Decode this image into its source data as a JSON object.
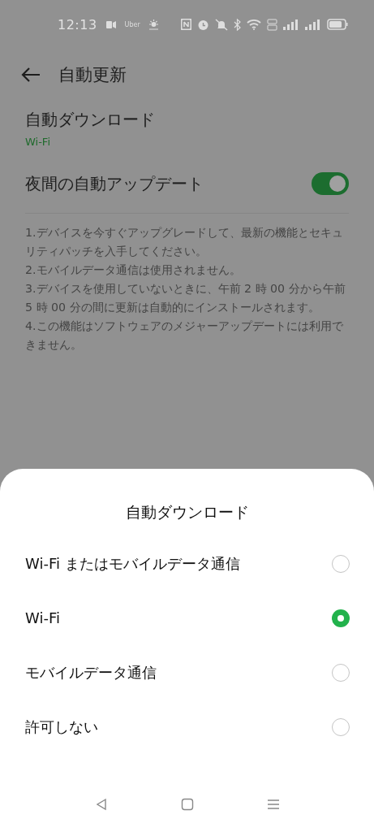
{
  "status_bar": {
    "time": "12:13",
    "app_label": "Uber"
  },
  "header": {
    "title": "自動更新"
  },
  "settings": [
    {
      "kind": "value",
      "title": "自動ダウンロード",
      "value": "Wi-Fi"
    },
    {
      "kind": "toggle",
      "title": "夜間の自動アップデート",
      "on": true
    }
  ],
  "notes": [
    "1.デバイスを今すぐアップグレードして、最新の機能とセキュリティパッチを入手してください。",
    "2.モバイルデータ通信は使用されません。",
    "3.デバイスを使用していないときに、午前 2 時 00 分から午前 5 時 00 分の間に更新は自動的にインストールされます。",
    "4.この機能はソフトウェアのメジャーアップデートには利用できません。"
  ],
  "sheet": {
    "title": "自動ダウンロード",
    "options": [
      {
        "label": "Wi-Fi またはモバイルデータ通信",
        "selected": false
      },
      {
        "label": "Wi-Fi",
        "selected": true
      },
      {
        "label": "モバイルデータ通信",
        "selected": false
      },
      {
        "label": "許可しない",
        "selected": false
      }
    ]
  }
}
